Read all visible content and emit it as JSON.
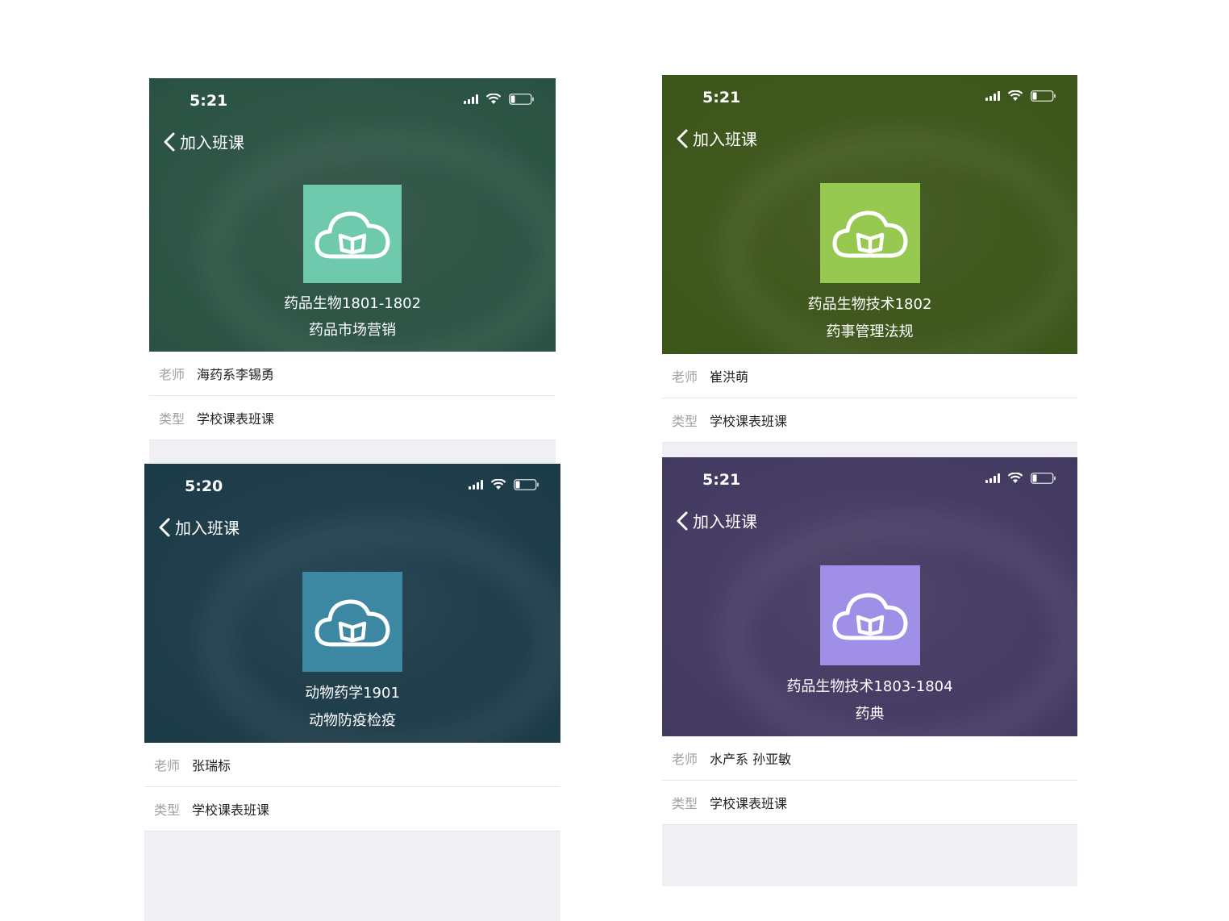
{
  "colors": {
    "card_a_logo": "#6fcaad",
    "card_b_logo": "#97c84f",
    "card_c_logo": "#3c88a2",
    "card_d_logo": "#a08fe6"
  },
  "icons": {
    "back": "chevron-left-icon",
    "signal": "signal-icon",
    "wifi": "wifi-icon",
    "battery": "battery-icon",
    "logo": "cloud-book-icon"
  },
  "cards": [
    {
      "status_time": "5:21",
      "nav_title": "加入班课",
      "class_name": "药品生物1801-1802",
      "course_name": "药品市场营销",
      "teacher_label": "老师",
      "teacher_value": "海药系李锡勇",
      "type_label": "类型",
      "type_value": "学校课表班课"
    },
    {
      "status_time": "5:21",
      "nav_title": "加入班课",
      "class_name": "药品生物技术1802",
      "course_name": "药事管理法规",
      "teacher_label": "老师",
      "teacher_value": "崔洪萌",
      "type_label": "类型",
      "type_value": "学校课表班课"
    },
    {
      "status_time": "5:20",
      "nav_title": "加入班课",
      "class_name": "动物药学1901",
      "course_name": "动物防疫检疫",
      "teacher_label": "老师",
      "teacher_value": "张瑞标",
      "type_label": "类型",
      "type_value": "学校课表班课"
    },
    {
      "status_time": "5:21",
      "nav_title": "加入班课",
      "class_name": "药品生物技术1803-1804",
      "course_name": "药典",
      "teacher_label": "老师",
      "teacher_value": "水产系 孙亚敏",
      "type_label": "类型",
      "type_value": "学校课表班课"
    }
  ]
}
